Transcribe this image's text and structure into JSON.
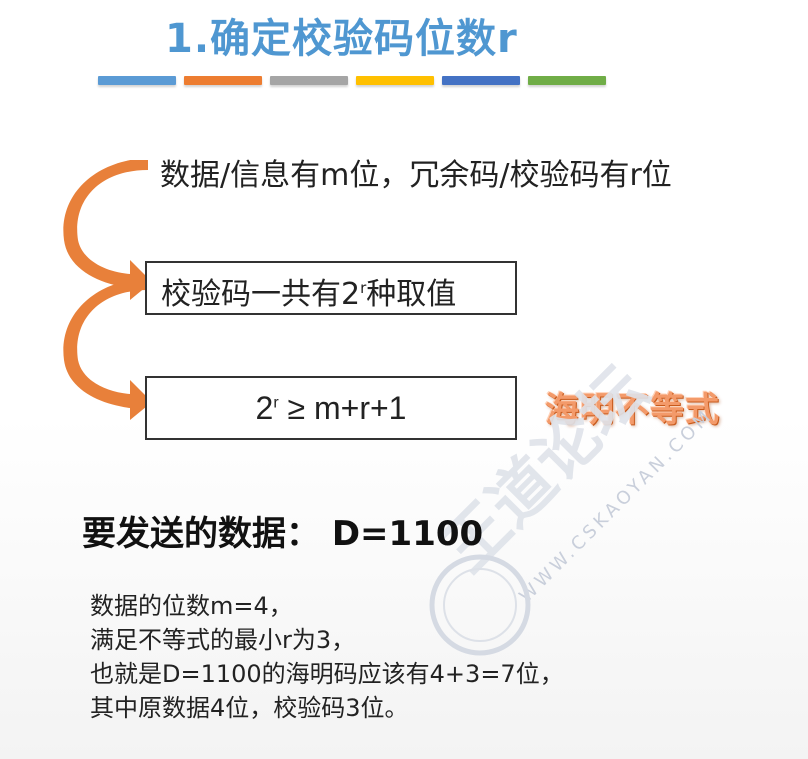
{
  "slide": {
    "title": "1.确定校验码位数r",
    "divider_colors": [
      "#5b9bd5",
      "#ed7d31",
      "#a5a5a5",
      "#ffc000",
      "#4472c4",
      "#70ad47"
    ],
    "line1": "数据/信息有m位，冗余码/校验码有r位",
    "box1": {
      "pre": "校验码一共有2",
      "sup": "r",
      "post": "种取值"
    },
    "box2": {
      "pre": "2",
      "sup": "r",
      "post": " ≥ m+r+1"
    },
    "hamming_label": "海明不等式",
    "send_line": "要发送的数据：  D=1100",
    "notes": [
      "数据的位数m=4，",
      "满足不等式的最小r为3，",
      "也就是D=1100的海明码应该有4+3=7位，",
      "其中原数据4位，校验码3位。"
    ],
    "arrow_color": "#e8803a"
  },
  "watermark": {
    "brand": "王道论坛",
    "url": "WWW.CSKAOYAN.COM"
  }
}
